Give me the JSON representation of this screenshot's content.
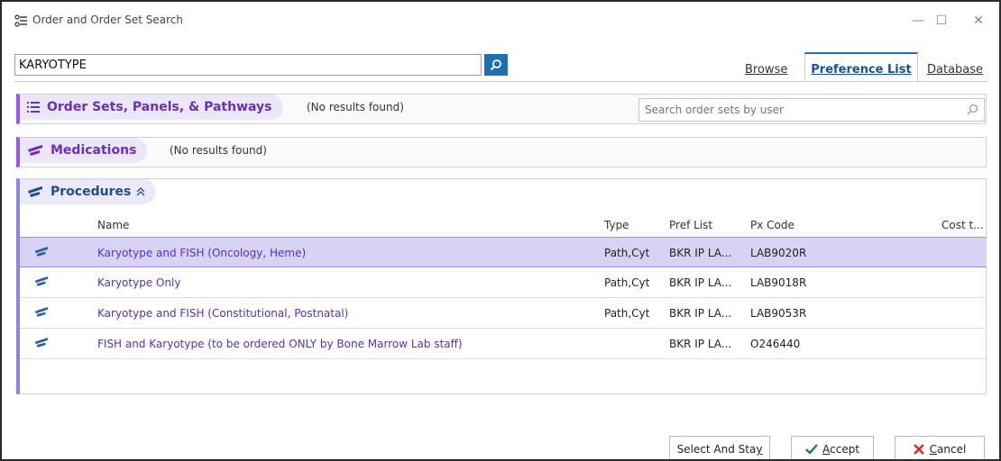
{
  "window": {
    "title": "Order and Order Set Search",
    "controls": {
      "minimize": "—",
      "maximize": "☐",
      "close": "✕"
    }
  },
  "search": {
    "value": "KARYOTYPE",
    "button_icon": "search-icon"
  },
  "tabs": [
    {
      "label": "Browse",
      "active": false
    },
    {
      "label": "Preference List",
      "active": true
    },
    {
      "label": "Database",
      "active": false
    }
  ],
  "sections": {
    "order_sets": {
      "title": "Order Sets, Panels, & Pathways",
      "status": "(No results found)",
      "user_search_placeholder": "Search order sets by user"
    },
    "medications": {
      "title": "Medications",
      "status": "(No results found)"
    },
    "procedures": {
      "title": "Procedures",
      "collapse_icon": "double-chevron-up-icon",
      "columns": [
        "Name",
        "Type",
        "Pref List",
        "Px Code",
        "Cost t..."
      ],
      "rows": [
        {
          "name": "Karyotype and FISH (Oncology, Heme)",
          "type": "Path,Cyt",
          "pref": "BKR IP LA...",
          "code": "LAB9020R",
          "selected": true
        },
        {
          "name": "Karyotype Only",
          "type": "Path,Cyt",
          "pref": "BKR IP LA...",
          "code": "LAB9018R",
          "selected": false
        },
        {
          "name": "Karyotype and FISH (Constitutional, Postnatal)",
          "type": "Path,Cyt",
          "pref": "BKR IP LA...",
          "code": "LAB9053R",
          "selected": false
        },
        {
          "name": "FISH and Karyotype (to be ordered ONLY by Bone Marrow Lab staff)",
          "type": "",
          "pref": "BKR IP LA...",
          "code": "O246440",
          "selected": false
        }
      ]
    }
  },
  "footer": {
    "select_and_stay": {
      "prefix": "Select And Sta",
      "accel": "y"
    },
    "accept": {
      "accel": "A",
      "rest": "ccept"
    },
    "cancel": {
      "accel": "C",
      "rest": "ancel"
    }
  },
  "colors": {
    "accent_purple": "#6a2fbf",
    "selected_row": "#d7d3f5",
    "tab_blue": "#1a4f99",
    "search_btn": "#1f6fb8",
    "cancel_x": "#d12b2b",
    "accept_check": "#2e7d32"
  }
}
